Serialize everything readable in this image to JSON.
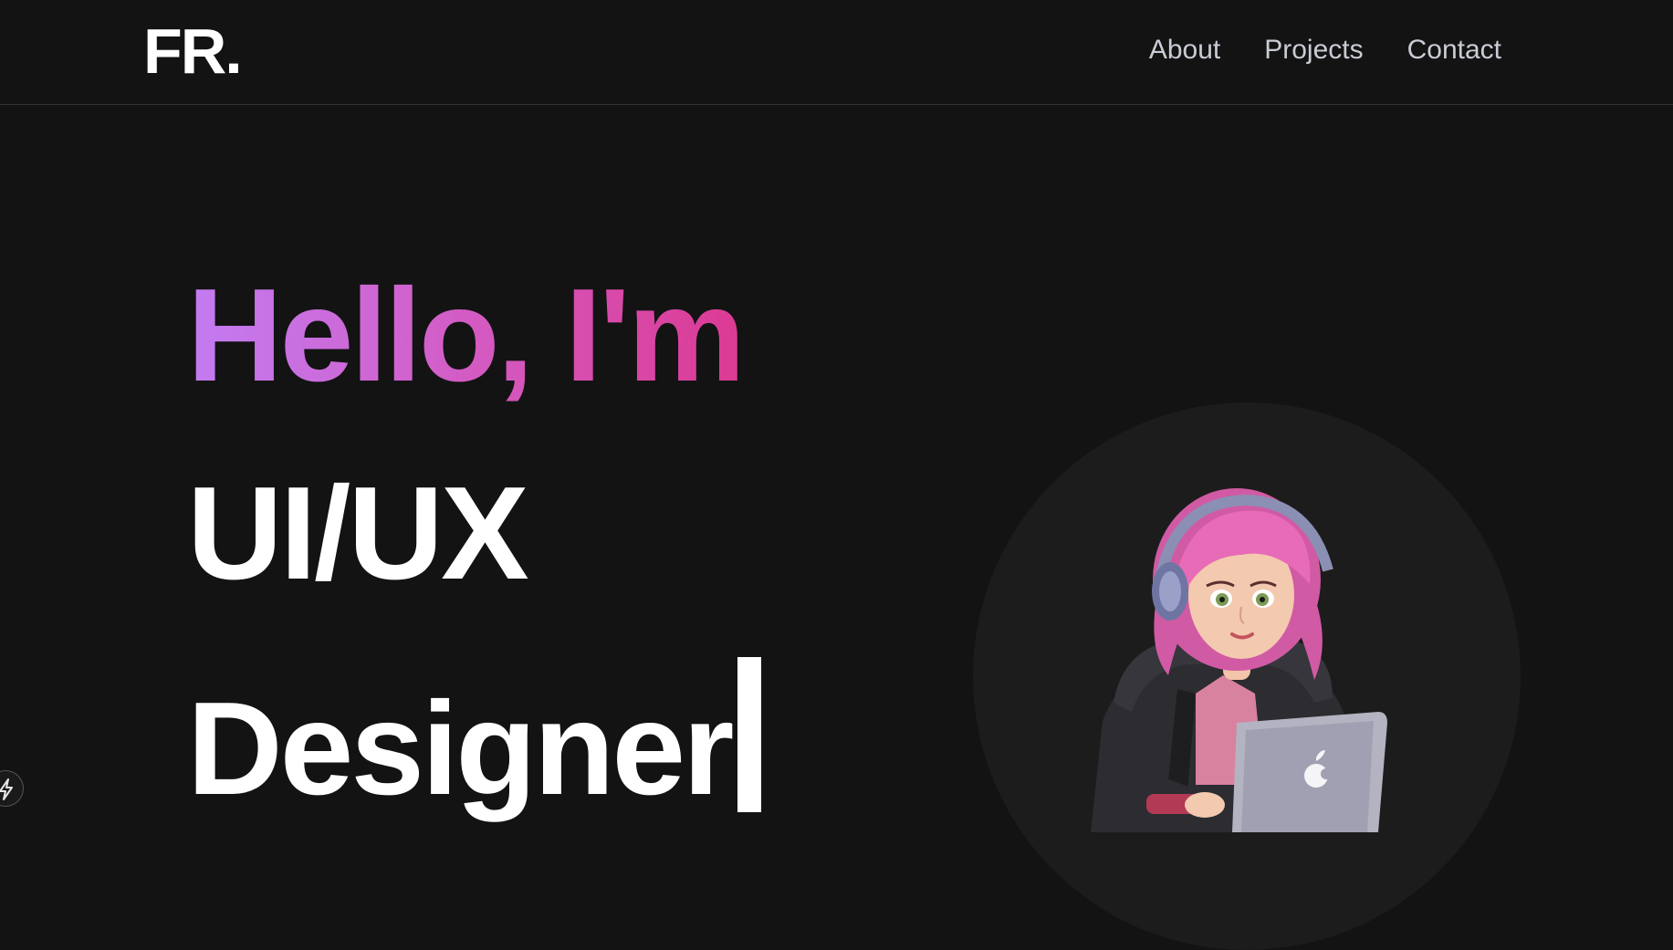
{
  "header": {
    "logo": "FR.",
    "nav": [
      {
        "label": "About"
      },
      {
        "label": "Projects"
      },
      {
        "label": "Contact"
      }
    ]
  },
  "hero": {
    "greeting": "Hello, I'm",
    "role_line1": "UI/UX",
    "role_line2": "Designer"
  },
  "colors": {
    "background": "#131313",
    "gradient_start": "#c27cf2",
    "gradient_end": "#dc3a92",
    "nav_text": "#c9ccd4"
  },
  "icons": {
    "floating_button": "lightning-bolt-icon",
    "illustration": "avatar-girl-with-headphones-and-laptop"
  }
}
